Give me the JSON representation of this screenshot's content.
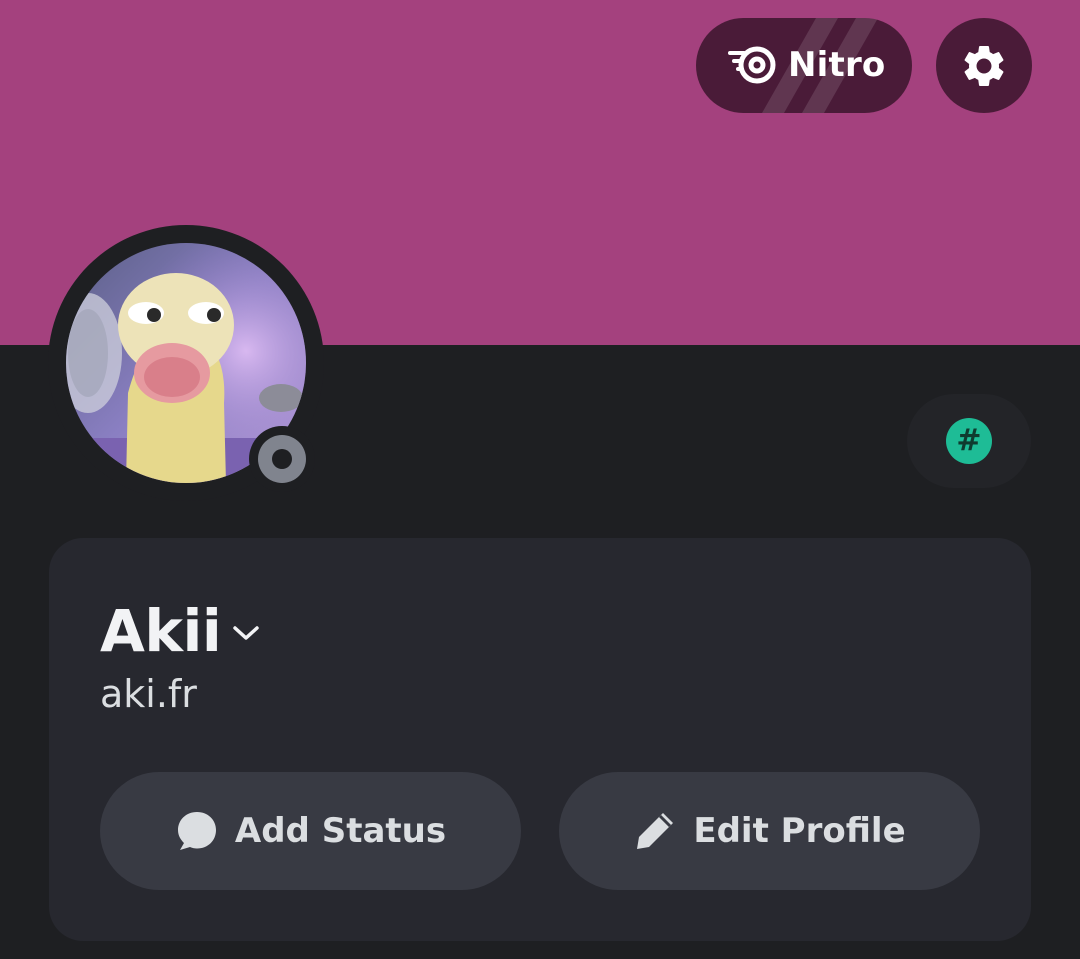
{
  "profile": {
    "display_name": "Akii",
    "username": "aki.fr",
    "status": "offline"
  },
  "header": {
    "nitro_label": "Nitro"
  },
  "badge": {
    "symbol": "#"
  },
  "actions": {
    "add_status_label": "Add Status",
    "edit_profile_label": "Edit Profile"
  },
  "colors": {
    "banner": "#a4417e",
    "background": "#1e1f22",
    "card": "#27282f",
    "button": "#383a43",
    "badge_accent": "#1ebc96",
    "offline_status": "#80848e"
  },
  "icons": {
    "nitro": "nitro-icon",
    "settings": "gear-icon",
    "badge": "hashtag-icon",
    "name_menu": "chevron-down-icon",
    "add_status": "speech-bubble-icon",
    "edit_profile": "pencil-icon"
  }
}
